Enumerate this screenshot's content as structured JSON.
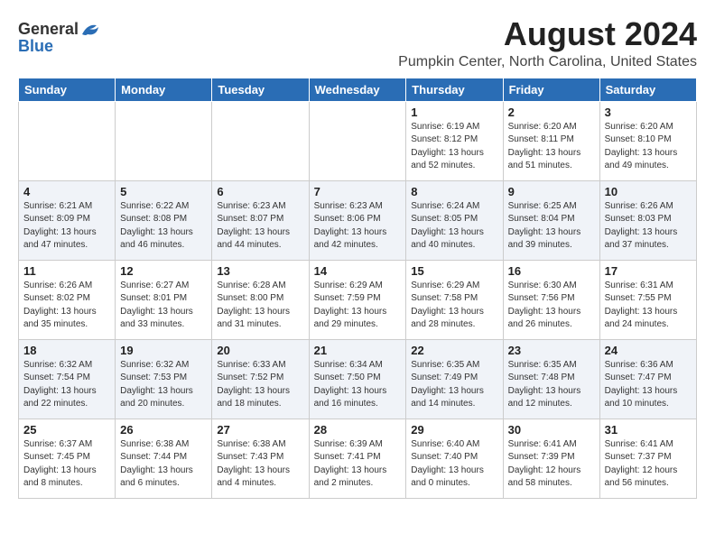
{
  "logo": {
    "general": "General",
    "blue": "Blue"
  },
  "title": "August 2024",
  "subtitle": "Pumpkin Center, North Carolina, United States",
  "days_of_week": [
    "Sunday",
    "Monday",
    "Tuesday",
    "Wednesday",
    "Thursday",
    "Friday",
    "Saturday"
  ],
  "weeks": [
    [
      {
        "day": "",
        "info": ""
      },
      {
        "day": "",
        "info": ""
      },
      {
        "day": "",
        "info": ""
      },
      {
        "day": "",
        "info": ""
      },
      {
        "day": "1",
        "info": "Sunrise: 6:19 AM\nSunset: 8:12 PM\nDaylight: 13 hours\nand 52 minutes."
      },
      {
        "day": "2",
        "info": "Sunrise: 6:20 AM\nSunset: 8:11 PM\nDaylight: 13 hours\nand 51 minutes."
      },
      {
        "day": "3",
        "info": "Sunrise: 6:20 AM\nSunset: 8:10 PM\nDaylight: 13 hours\nand 49 minutes."
      }
    ],
    [
      {
        "day": "4",
        "info": "Sunrise: 6:21 AM\nSunset: 8:09 PM\nDaylight: 13 hours\nand 47 minutes."
      },
      {
        "day": "5",
        "info": "Sunrise: 6:22 AM\nSunset: 8:08 PM\nDaylight: 13 hours\nand 46 minutes."
      },
      {
        "day": "6",
        "info": "Sunrise: 6:23 AM\nSunset: 8:07 PM\nDaylight: 13 hours\nand 44 minutes."
      },
      {
        "day": "7",
        "info": "Sunrise: 6:23 AM\nSunset: 8:06 PM\nDaylight: 13 hours\nand 42 minutes."
      },
      {
        "day": "8",
        "info": "Sunrise: 6:24 AM\nSunset: 8:05 PM\nDaylight: 13 hours\nand 40 minutes."
      },
      {
        "day": "9",
        "info": "Sunrise: 6:25 AM\nSunset: 8:04 PM\nDaylight: 13 hours\nand 39 minutes."
      },
      {
        "day": "10",
        "info": "Sunrise: 6:26 AM\nSunset: 8:03 PM\nDaylight: 13 hours\nand 37 minutes."
      }
    ],
    [
      {
        "day": "11",
        "info": "Sunrise: 6:26 AM\nSunset: 8:02 PM\nDaylight: 13 hours\nand 35 minutes."
      },
      {
        "day": "12",
        "info": "Sunrise: 6:27 AM\nSunset: 8:01 PM\nDaylight: 13 hours\nand 33 minutes."
      },
      {
        "day": "13",
        "info": "Sunrise: 6:28 AM\nSunset: 8:00 PM\nDaylight: 13 hours\nand 31 minutes."
      },
      {
        "day": "14",
        "info": "Sunrise: 6:29 AM\nSunset: 7:59 PM\nDaylight: 13 hours\nand 29 minutes."
      },
      {
        "day": "15",
        "info": "Sunrise: 6:29 AM\nSunset: 7:58 PM\nDaylight: 13 hours\nand 28 minutes."
      },
      {
        "day": "16",
        "info": "Sunrise: 6:30 AM\nSunset: 7:56 PM\nDaylight: 13 hours\nand 26 minutes."
      },
      {
        "day": "17",
        "info": "Sunrise: 6:31 AM\nSunset: 7:55 PM\nDaylight: 13 hours\nand 24 minutes."
      }
    ],
    [
      {
        "day": "18",
        "info": "Sunrise: 6:32 AM\nSunset: 7:54 PM\nDaylight: 13 hours\nand 22 minutes."
      },
      {
        "day": "19",
        "info": "Sunrise: 6:32 AM\nSunset: 7:53 PM\nDaylight: 13 hours\nand 20 minutes."
      },
      {
        "day": "20",
        "info": "Sunrise: 6:33 AM\nSunset: 7:52 PM\nDaylight: 13 hours\nand 18 minutes."
      },
      {
        "day": "21",
        "info": "Sunrise: 6:34 AM\nSunset: 7:50 PM\nDaylight: 13 hours\nand 16 minutes."
      },
      {
        "day": "22",
        "info": "Sunrise: 6:35 AM\nSunset: 7:49 PM\nDaylight: 13 hours\nand 14 minutes."
      },
      {
        "day": "23",
        "info": "Sunrise: 6:35 AM\nSunset: 7:48 PM\nDaylight: 13 hours\nand 12 minutes."
      },
      {
        "day": "24",
        "info": "Sunrise: 6:36 AM\nSunset: 7:47 PM\nDaylight: 13 hours\nand 10 minutes."
      }
    ],
    [
      {
        "day": "25",
        "info": "Sunrise: 6:37 AM\nSunset: 7:45 PM\nDaylight: 13 hours\nand 8 minutes."
      },
      {
        "day": "26",
        "info": "Sunrise: 6:38 AM\nSunset: 7:44 PM\nDaylight: 13 hours\nand 6 minutes."
      },
      {
        "day": "27",
        "info": "Sunrise: 6:38 AM\nSunset: 7:43 PM\nDaylight: 13 hours\nand 4 minutes."
      },
      {
        "day": "28",
        "info": "Sunrise: 6:39 AM\nSunset: 7:41 PM\nDaylight: 13 hours\nand 2 minutes."
      },
      {
        "day": "29",
        "info": "Sunrise: 6:40 AM\nSunset: 7:40 PM\nDaylight: 13 hours\nand 0 minutes."
      },
      {
        "day": "30",
        "info": "Sunrise: 6:41 AM\nSunset: 7:39 PM\nDaylight: 12 hours\nand 58 minutes."
      },
      {
        "day": "31",
        "info": "Sunrise: 6:41 AM\nSunset: 7:37 PM\nDaylight: 12 hours\nand 56 minutes."
      }
    ]
  ]
}
